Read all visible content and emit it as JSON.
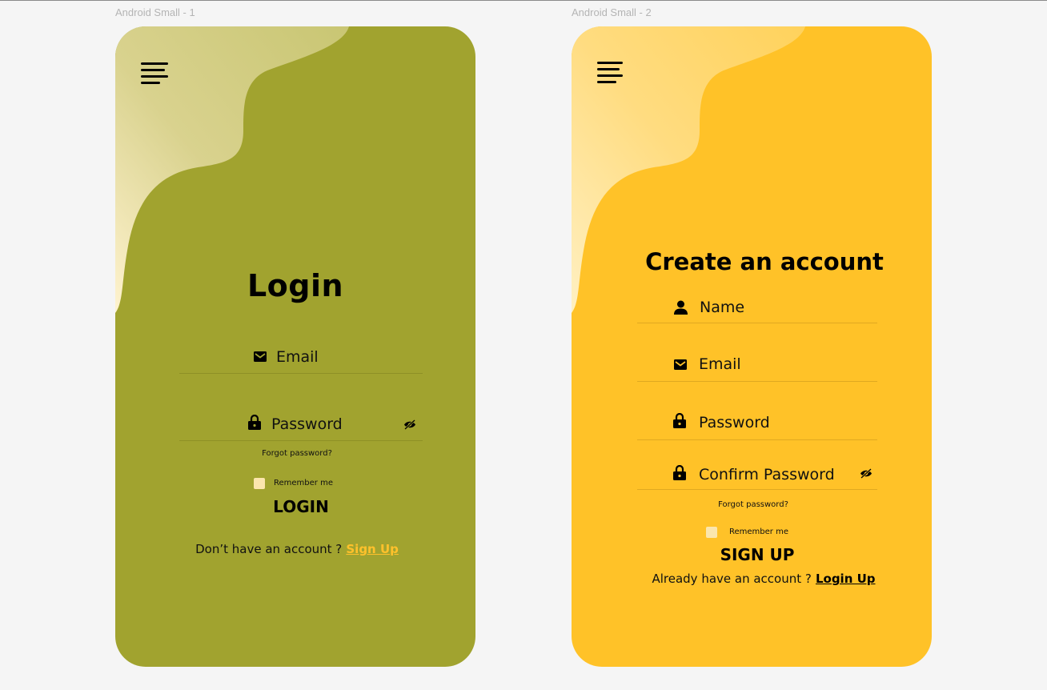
{
  "canvas": {
    "bg": "#f5f5f5"
  },
  "frame1": {
    "label": "Android Small - 1",
    "bg": "#a1a32f",
    "accent": "#ffc12b",
    "title": "Login",
    "email_label": "Email",
    "password_label": "Password",
    "forgot": "Forgot password?",
    "remember": "Remember me",
    "button": "LOGIN",
    "footer_text": "Don’t have an account ?",
    "footer_link": "Sign Up",
    "icons": [
      "menu-icon",
      "mail-icon",
      "lock-icon",
      "eye-off-icon"
    ]
  },
  "frame2": {
    "label": "Android Small - 2",
    "bg": "#ffc228",
    "title": "Create an account",
    "name_label": "Name",
    "email_label": "Email",
    "password_label": "Password",
    "confirm_label": "Confirm Password",
    "forgot": "Forgot password?",
    "remember": "Remember me",
    "button": "SIGN UP",
    "footer_text": "Already have an account ?",
    "footer_link": "Login Up",
    "icons": [
      "menu-icon",
      "user-icon",
      "mail-icon",
      "lock-icon",
      "eye-off-icon"
    ]
  }
}
